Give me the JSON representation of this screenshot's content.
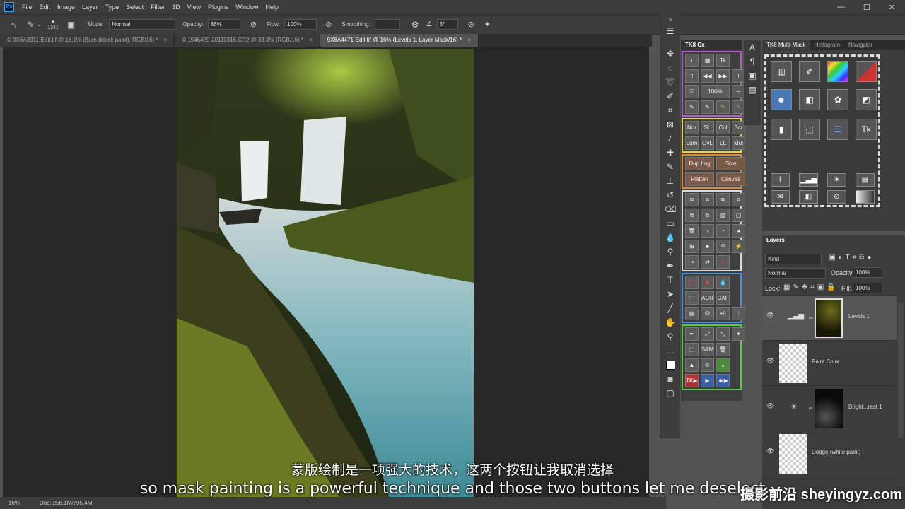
{
  "menubar": {
    "logo": "Ps",
    "items": [
      "File",
      "Edit",
      "Image",
      "Layer",
      "Type",
      "Select",
      "Filter",
      "3D",
      "View",
      "Plugins",
      "Window",
      "Help"
    ],
    "window_controls": [
      "—",
      "☐",
      "✕"
    ]
  },
  "options": {
    "brush_size": "1341",
    "mode_label": "Mode:",
    "mode_value": "Normal",
    "opacity_label": "Opacity:",
    "opacity_value": "86%",
    "flow_label": "Flow:",
    "flow_value": "100%",
    "smoothing_label": "Smoothing:",
    "angle_value": "3°"
  },
  "tabs": [
    {
      "label": "© 9X6A3911-Edit.tif @ 16.1% (Burn (black paint), RGB/16) *",
      "close": "×"
    },
    {
      "label": "© 1546489-20110316.CR2 @ 33.3% (RGB/16) *",
      "close": "×"
    },
    {
      "label": "9X6A4471-Edit.tif @ 16% (Levels 1, Layer Mask/16) *",
      "close": "×"
    }
  ],
  "status": {
    "zoom": "16%",
    "doc": "Doc: 256.1M/795.4M"
  },
  "tkcx": {
    "title": "TK8 Cx",
    "blend": [
      "Nor",
      "SL",
      "Col",
      "Scr",
      "Lum",
      "OvL",
      "LL",
      "Mul"
    ],
    "dup_img": "Dup Img",
    "size": "Size",
    "flatten": "Flatten",
    "canvas": "Canvas",
    "hundred": "100%",
    "acr": "ACR",
    "caf": "CAF",
    "plusminus": "+/-",
    "sm": "S&M",
    "tk": "TK"
  },
  "multimask": {
    "tabs": [
      "TK8 Multi-Mask",
      "Histogram",
      "Navigator"
    ]
  },
  "layers": {
    "title": "Layers",
    "kind": "Kind",
    "blend_mode": "Normal",
    "opacity_label": "Opacity:",
    "opacity_value": "100%",
    "lock_label": "Lock:",
    "fill_label": "Fill:",
    "fill_value": "100%",
    "items": [
      {
        "name": "Levels 1"
      },
      {
        "name": "Paint Color"
      },
      {
        "name": "Bright...rast 1"
      },
      {
        "name": "Dodge (white paint)"
      }
    ]
  },
  "subtitles": {
    "cn": "蒙版绘制是一项强大的技术，这两个按钮让我取消选择",
    "en": "so mask painting is a powerful technique and those two buttons let me deselect"
  },
  "watermark": "摄影前沿 sheyingyz.com"
}
